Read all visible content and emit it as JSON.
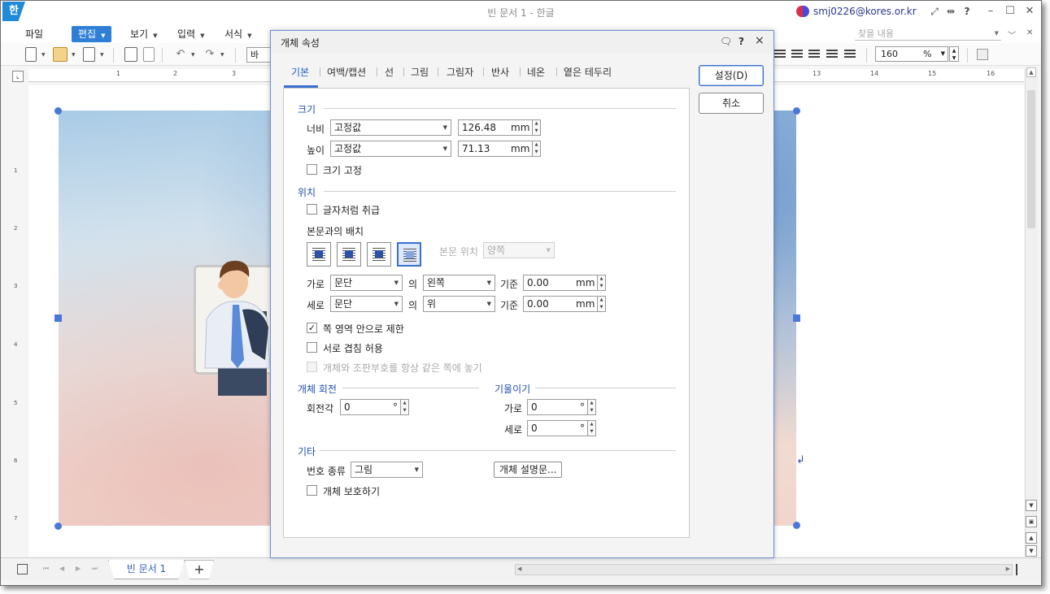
{
  "window": {
    "logo": "한",
    "title": "빈 문서 1 - 한글",
    "account_email": "smj0226@kores.or.kr",
    "buttons": [
      "fullscreen-icon",
      "split-icon",
      "help",
      "minimize",
      "maximize",
      "close"
    ],
    "help_label": "?"
  },
  "menubar": {
    "file": "파일",
    "edit": "편집",
    "view": "보기",
    "insert": "입력",
    "format": "서식",
    "find_placeholder": "찾을 내용"
  },
  "toolbar": {
    "style_value": "바",
    "zoom_value": "160",
    "zoom_unit": "%"
  },
  "ruler": {
    "h_numbers": [
      "1",
      "2",
      "3",
      "13",
      "14",
      "15",
      "16"
    ],
    "v_numbers": [
      "1",
      "2",
      "3",
      "4",
      "5",
      "6",
      "7"
    ]
  },
  "tabs": {
    "doc_tab": "빈 문서 1",
    "add_tab": "+"
  },
  "dialog": {
    "title": "개체 속성",
    "help": "?",
    "close": "×",
    "tabs": [
      "기본",
      "여백/캡션",
      "선",
      "그림",
      "그림자",
      "반사",
      "네온",
      "옅은 테두리"
    ],
    "active_tab": "기본",
    "ok_button": "설정(D)",
    "cancel_button": "취소",
    "size": {
      "section": "크기",
      "width_label": "너비",
      "width_mode": "고정값",
      "width_value": "126.48",
      "height_label": "높이",
      "height_mode": "고정값",
      "height_value": "71.13",
      "unit": "mm",
      "lock_label": "크기 고정",
      "lock_checked": false
    },
    "position": {
      "section": "위치",
      "treat_as_char_label": "글자처럼 취급",
      "treat_as_char_checked": false,
      "wrap_label": "본문과의 배치",
      "wrap_options": [
        "square",
        "tight",
        "through",
        "behind-text"
      ],
      "wrap_selected": "behind-text",
      "text_pos_label": "본문 위치",
      "text_pos_value": "양쪽",
      "horiz_label": "가로",
      "horiz_rel": "문단",
      "of_label": "의",
      "horiz_align": "왼쪽",
      "ref_label": "기준",
      "horiz_offset": "0.00",
      "vert_label": "세로",
      "vert_rel": "문단",
      "vert_align": "위",
      "vert_offset": "0.00",
      "unit": "mm",
      "limit_page_label": "쪽 영역 안으로 제한",
      "limit_page_checked": true,
      "allow_overlap_label": "서로 겹침 허용",
      "allow_overlap_checked": false,
      "same_page_label": "개체와 조판부호를 항상 같은 쪽에 놓기",
      "same_page_checked": false
    },
    "rotation": {
      "section": "개체 회전",
      "angle_label": "회전각",
      "angle_value": "0",
      "deg": "°"
    },
    "skew": {
      "section": "기울이기",
      "horiz_label": "가로",
      "horiz_value": "0",
      "vert_label": "세로",
      "vert_value": "0",
      "deg": "°"
    },
    "misc": {
      "section": "기타",
      "numbering_label": "번호 종류",
      "numbering_value": "그림",
      "description_button": "개체 설명문...",
      "protect_label": "개체 보호하기",
      "protect_checked": false
    }
  },
  "colors": {
    "accent": "#2f7fd6",
    "handle": "#4a78d8",
    "section_title": "#1f4fb0"
  }
}
